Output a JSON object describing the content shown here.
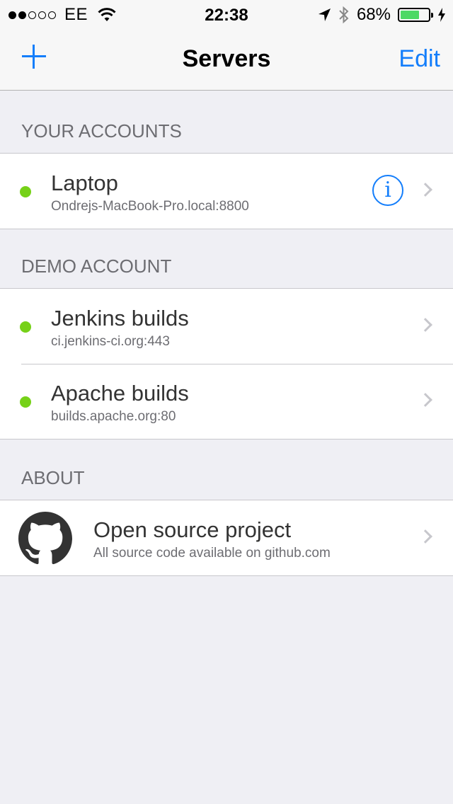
{
  "statusbar": {
    "carrier": "EE",
    "time": "22:38",
    "battery_percent": "68%",
    "battery_level": 0.68,
    "icons": [
      "signal-dots-icon",
      "wifi-icon",
      "location-arrow-icon",
      "bluetooth-icon",
      "battery-icon",
      "charging-bolt-icon"
    ]
  },
  "navbar": {
    "add_icon": "plus-icon",
    "title": "Servers",
    "edit_label": "Edit"
  },
  "sections": {
    "accounts": {
      "header": "YOUR ACCOUNTS",
      "items": [
        {
          "title": "Laptop",
          "subtitle": "Ondrejs-MacBook-Pro.local:8800",
          "status_color": "#76d118",
          "has_info": true
        }
      ]
    },
    "demo": {
      "header": "DEMO ACCOUNT",
      "items": [
        {
          "title": "Jenkins builds",
          "subtitle": "ci.jenkins-ci.org:443",
          "status_color": "#76d118"
        },
        {
          "title": "Apache builds",
          "subtitle": "builds.apache.org:80",
          "status_color": "#76d118"
        }
      ]
    },
    "about": {
      "header": "ABOUT",
      "items": [
        {
          "title": "Open source project",
          "subtitle": "All source code available on github.com",
          "icon": "github-icon"
        }
      ]
    }
  },
  "colors": {
    "accent": "#147efb",
    "status_online": "#76d118",
    "background": "#efeff4"
  }
}
